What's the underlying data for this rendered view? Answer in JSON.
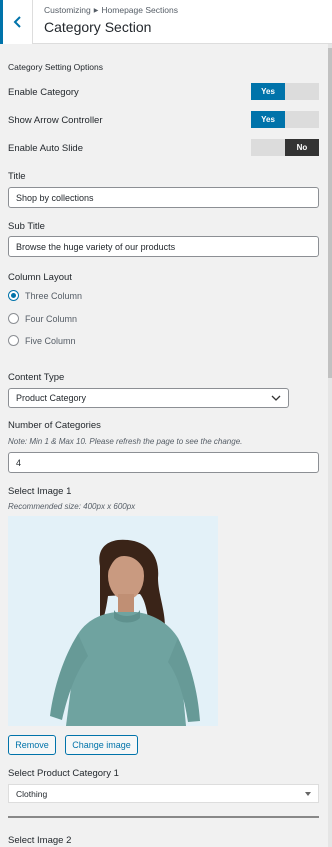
{
  "header": {
    "breadcrumb_root": "Customizing",
    "breadcrumb_parent": "Homepage Sections",
    "title": "Category Section"
  },
  "settings_heading": "Category Setting Options",
  "toggles": [
    {
      "label": "Enable Category",
      "yes": "Yes",
      "no": "",
      "state": "on"
    },
    {
      "label": "Show Arrow Controller",
      "yes": "Yes",
      "no": "",
      "state": "on"
    },
    {
      "label": "Enable Auto Slide",
      "yes": "",
      "no": "No",
      "state": "off"
    }
  ],
  "title_field": {
    "label": "Title",
    "value": "Shop by collections"
  },
  "subtitle_field": {
    "label": "Sub Title",
    "value": "Browse the huge variety of our products"
  },
  "column_layout": {
    "label": "Column Layout",
    "options": [
      "Three Column",
      "Four Column",
      "Five Column"
    ],
    "selected": "Three Column"
  },
  "content_type": {
    "label": "Content Type",
    "value": "Product Category"
  },
  "num_categories": {
    "label": "Number of Categories",
    "note": "Note: Min 1 & Max 10. Please refresh the page to see the change.",
    "value": "4"
  },
  "image1": {
    "label": "Select Image 1",
    "note": "Recommended size: 400px x 600px",
    "remove": "Remove",
    "change": "Change image"
  },
  "product_category1": {
    "label": "Select Product Category 1",
    "value": "Clothing"
  },
  "image2": {
    "label": "Select Image 2"
  },
  "colors": {
    "accent": "#0073aa",
    "background": "#f1f1f1"
  }
}
